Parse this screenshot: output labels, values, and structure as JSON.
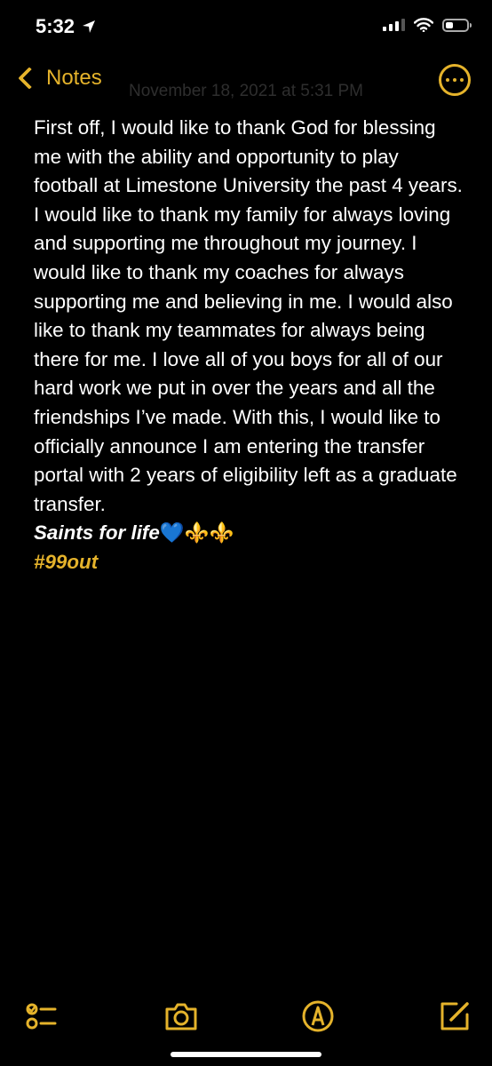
{
  "status_bar": {
    "time": "5:32",
    "battery_level": 0.35,
    "signal_bars": 3
  },
  "nav": {
    "back_label": "Notes",
    "date": "November 18, 2021 at 5:31 PM"
  },
  "note": {
    "body": "First off, I would like to thank God for blessing me with the ability and opportunity to play football at Limestone University the past 4 years. I would like to thank my family for always loving and supporting me throughout my journey. I would like to thank my coaches for always supporting me and believing in me. I would also like to thank my teammates for always being there for me. I love all of you boys for all of our hard work we put in over the years and all the friendships I’ve made. With this, I would like to officially announce I am entering the transfer portal with 2 years of eligibility left as a graduate transfer.",
    "saints_line": "Saints for life",
    "saints_emoji": "💙⚜️⚜️",
    "hashtag": "#99out"
  },
  "toolbar": {
    "icons": [
      "checklist-icon",
      "camera-icon",
      "markup-icon",
      "compose-icon"
    ]
  },
  "colors": {
    "accent": "#e5b32b",
    "background": "#000000",
    "text": "#ffffff"
  }
}
